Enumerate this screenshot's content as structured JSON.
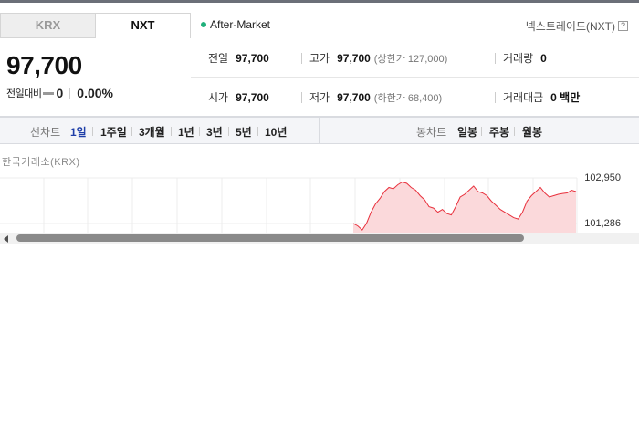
{
  "tabs": [
    {
      "label": "KRX",
      "active": false
    },
    {
      "label": "NXT",
      "active": true
    }
  ],
  "session": {
    "label": "After-Market",
    "dot_color": "#1fb07b"
  },
  "venue": {
    "label": "넥스트레이드(NXT)",
    "help_glyph": "?"
  },
  "quote": {
    "price": "97,700",
    "change_label": "전일대비",
    "change_amount": "0",
    "change_rate": "0.00%"
  },
  "stats": {
    "prev_close": {
      "label": "전일",
      "value": "97,700"
    },
    "high": {
      "label": "고가",
      "value": "97,700",
      "sub": "(상한가 127,000)"
    },
    "volume": {
      "label": "거래량",
      "value": "0"
    },
    "open": {
      "label": "시가",
      "value": "97,700"
    },
    "low": {
      "label": "저가",
      "value": "97,700",
      "sub": "(하한가 68,400)"
    },
    "trade_value": {
      "label": "거래대금",
      "value": "0 백만"
    }
  },
  "period_bar": {
    "line_label": "선차트",
    "line_periods": [
      "1일",
      "1주일",
      "3개월",
      "1년",
      "3년",
      "5년",
      "10년"
    ],
    "selected": "1일",
    "candle_label": "봉차트",
    "candle_periods": [
      "일봉",
      "주봉",
      "월봉"
    ]
  },
  "chart_data": {
    "type": "area",
    "source": "한국거래소(KRX)",
    "y_ticks": [
      "102,950",
      "101,286"
    ],
    "line_color": "#e8303c",
    "fill_color": "#fbd9db",
    "note": "intraday price line, visible portion only",
    "x": [
      0,
      1,
      2,
      3,
      4,
      5,
      6,
      7,
      8,
      9,
      10,
      11,
      12,
      13,
      14,
      15,
      16,
      17,
      18,
      19,
      20,
      21,
      22,
      23,
      24,
      25,
      26,
      27,
      28,
      29,
      30,
      31,
      32,
      33,
      34,
      35,
      36,
      37,
      38,
      39,
      40,
      41,
      42,
      43,
      44,
      45,
      46,
      47,
      48,
      49,
      50
    ],
    "y": [
      101290,
      101200,
      101050,
      101300,
      101700,
      102000,
      102200,
      102450,
      102600,
      102550,
      102700,
      102800,
      102750,
      102600,
      102500,
      102300,
      102150,
      101900,
      101850,
      101700,
      101800,
      101650,
      101600,
      101900,
      102250,
      102350,
      102500,
      102650,
      102450,
      102400,
      102300,
      102100,
      101950,
      101800,
      101700,
      101600,
      101500,
      101450,
      101700,
      102100,
      102300,
      102450,
      102600,
      102400,
      102250,
      102300,
      102350,
      102380,
      102400,
      102500,
      102450
    ]
  },
  "scrollbar": {
    "left_arrow": "scroll-left"
  }
}
